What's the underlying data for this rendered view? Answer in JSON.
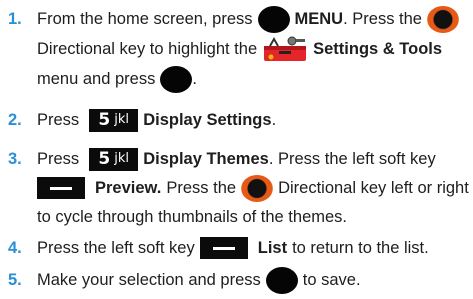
{
  "steps": [
    {
      "number": "1.",
      "line1_a": "From the home screen, press",
      "line1_b": "MENU",
      "line1_c": ". Press the",
      "line2_a": "Directional key to highlight the",
      "line2_b": "Settings & Tools",
      "line3_a": "menu and press",
      "line3_b": "."
    },
    {
      "number": "2.",
      "a": "Press",
      "key_digit": "5",
      "key_letters": "jkl",
      "b": "Display Settings",
      "c": "."
    },
    {
      "number": "3.",
      "line1_a": "Press",
      "key_digit": "5",
      "key_letters": "jkl",
      "line1_b": "Display Themes",
      "line1_c": ". Press the left soft key",
      "line2_a": "Preview.",
      "line2_b": "Press the",
      "line2_c": "Directional key left or right",
      "line3": "to cycle through thumbnails of the themes."
    },
    {
      "number": "4.",
      "a": "Press the left soft key",
      "b": "List",
      "c": "to return to the list."
    },
    {
      "number": "5.",
      "a": "Make your selection and press",
      "b": "to save."
    }
  ],
  "icons": {
    "select_key": "black-round-select-key-icon",
    "directional_key": "orange-directional-key-icon",
    "number_key": "5-jkl-key-icon",
    "soft_key": "left-soft-key-icon",
    "settings_tools": "settings-and-tools-toolbox-icon"
  },
  "colors": {
    "step_number": "#2b8fd3",
    "text": "#1e1e1e",
    "key_black": "#050505",
    "directional_orange": "#e65a17",
    "toolbox_red": "#e4262a"
  }
}
